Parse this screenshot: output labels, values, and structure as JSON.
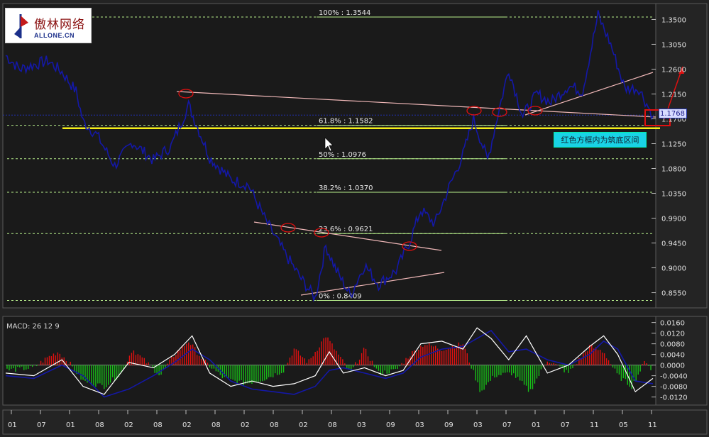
{
  "logo": {
    "cn": "傲林网络",
    "url": "ALLONE.CN"
  },
  "note": "红色方框内为筑底区间",
  "current_price": "1.1768",
  "macd": {
    "title": "MACD: 26 12 9"
  },
  "colors": {
    "price_line": "#1418a6",
    "fib_line": "#b8f08c",
    "support_line": "#f5ef1a",
    "trend_line": "#f0b8b8",
    "circle": "#e01010",
    "macd_pos": "#e01010",
    "macd_neg": "#18c018",
    "macd_line": "#ffffff",
    "signal_line": "#1418a6",
    "note_bg": "#19d3e6"
  },
  "chart_data": [
    {
      "type": "line",
      "name": "price",
      "yaxis_ticks": [
        "1.3500",
        "1.3050",
        "1.2600",
        "1.2150",
        "1.1700",
        "1.1250",
        "1.0800",
        "1.0350",
        "0.9900",
        "0.9450",
        "0.9000",
        "0.8550"
      ],
      "ylim": [
        0.83,
        1.375
      ],
      "x_tick_labels": [
        "01",
        "07",
        "01",
        "08",
        "02",
        "08",
        "02",
        "08",
        "02",
        "08",
        "02",
        "08",
        "03",
        "09",
        "03",
        "09",
        "03",
        "07",
        "01",
        "07",
        "11",
        "05",
        "11"
      ],
      "fib_levels": [
        {
          "label": "100% : 1.3544",
          "value": 1.3544
        },
        {
          "label": "61.8% : 1.1582",
          "value": 1.1582
        },
        {
          "label": "50%   : 1.0976",
          "value": 1.0976
        },
        {
          "label": "38.2% : 1.0370",
          "value": 1.037
        },
        {
          "label": "23.6% : 0.9621",
          "value": 0.9621
        },
        {
          "label": "0%   : 0.8409",
          "value": 0.8409
        }
      ],
      "support_level": 1.153,
      "current_level": 1.1768,
      "x": [
        0,
        20,
        40,
        60,
        80,
        100,
        110,
        130,
        155,
        180,
        210,
        235,
        260,
        290,
        320,
        345,
        370,
        395,
        420,
        440,
        455,
        470,
        490,
        510,
        530,
        555,
        575,
        590,
        610,
        630,
        650,
        665,
        685,
        700,
        715,
        735,
        755,
        775,
        800,
        820,
        842,
        860,
        880,
        900,
        920
      ],
      "y": [
        1.285,
        1.26,
        1.268,
        1.275,
        1.255,
        1.22,
        1.165,
        1.14,
        1.085,
        1.128,
        1.095,
        1.12,
        1.195,
        1.1,
        1.06,
        1.05,
        0.985,
        0.93,
        0.88,
        0.845,
        0.94,
        0.895,
        0.85,
        0.905,
        0.87,
        0.895,
        0.95,
        1.005,
        0.98,
        1.045,
        1.105,
        1.17,
        1.095,
        1.18,
        1.26,
        1.175,
        1.215,
        1.2,
        1.23,
        1.22,
        1.358,
        1.305,
        1.225,
        1.225,
        1.175
      ]
    },
    {
      "type": "bar",
      "name": "MACD histogram",
      "yaxis_ticks": [
        "0.0160",
        "0.0120",
        "0.0080",
        "0.0040",
        "0.0000",
        "-0.0040",
        "-0.0080",
        "-0.0120"
      ],
      "ylim": [
        -0.0145,
        0.0175
      ],
      "x": [
        0,
        40,
        60,
        75,
        90,
        110,
        140,
        165,
        180,
        200,
        220,
        240,
        260,
        280,
        310,
        340,
        370,
        395,
        410,
        430,
        455,
        475,
        490,
        510,
        530,
        555,
        575,
        595,
        620,
        650,
        675,
        695,
        720,
        745,
        770,
        800,
        830,
        850,
        870,
        890,
        910,
        920
      ],
      "values": [
        -0.002,
        -0.001,
        0.003,
        0.005,
        0.001,
        -0.006,
        -0.008,
        -0.003,
        0.006,
        0.001,
        -0.004,
        0.004,
        0.009,
        0.002,
        -0.005,
        -0.007,
        -0.005,
        -0.002,
        0.006,
        0.001,
        0.011,
        0.003,
        -0.003,
        0.006,
        -0.003,
        -0.002,
        0.004,
        0.008,
        0.006,
        0.008,
        -0.01,
        -0.004,
        -0.003,
        -0.01,
        0.002,
        -0.003,
        0.007,
        0.005,
        -0.004,
        -0.008,
        0.002,
        -0.003
      ]
    },
    {
      "type": "line",
      "name": "MACD / signal",
      "x": [
        0,
        40,
        80,
        110,
        140,
        175,
        210,
        240,
        265,
        290,
        320,
        350,
        380,
        410,
        440,
        460,
        480,
        510,
        540,
        565,
        590,
        620,
        650,
        670,
        690,
        715,
        740,
        770,
        800,
        830,
        850,
        870,
        895,
        920
      ],
      "macd": [
        -0.003,
        -0.004,
        0.002,
        -0.008,
        -0.011,
        0.001,
        -0.001,
        0.004,
        0.011,
        -0.003,
        -0.008,
        -0.006,
        -0.008,
        -0.007,
        -0.004,
        0.005,
        -0.003,
        -0.001,
        -0.004,
        -0.002,
        0.008,
        0.009,
        0.006,
        0.014,
        0.01,
        0.002,
        0.011,
        -0.003,
        0.0,
        0.007,
        0.011,
        0.004,
        -0.01,
        -0.005
      ],
      "signal": [
        -0.004,
        -0.005,
        0.0,
        -0.004,
        -0.012,
        -0.009,
        -0.004,
        0.001,
        0.006,
        0.002,
        -0.006,
        -0.009,
        -0.01,
        -0.011,
        -0.008,
        -0.002,
        -0.001,
        -0.003,
        -0.005,
        -0.003,
        0.003,
        0.006,
        0.007,
        0.01,
        0.013,
        0.005,
        0.006,
        0.002,
        0.0,
        0.004,
        0.009,
        0.006,
        -0.006,
        -0.007
      ]
    }
  ]
}
